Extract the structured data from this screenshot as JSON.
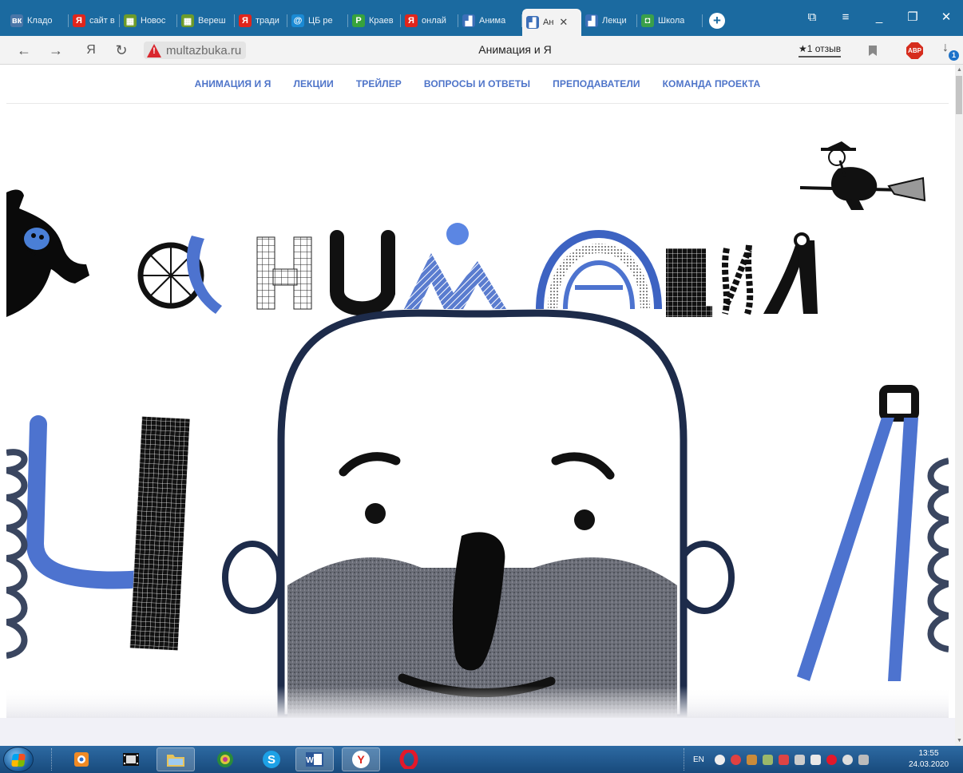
{
  "browser": {
    "tabs": [
      {
        "title": "Кладо",
        "icon": "vk-icon",
        "color": "#4a76a8",
        "glyph": "вк"
      },
      {
        "title": "сайт в",
        "icon": "yandex-icon",
        "color": "#e1251b",
        "glyph": "Я"
      },
      {
        "title": "Новос",
        "icon": "site-icon",
        "color": "#6d9b2a",
        "glyph": "▦"
      },
      {
        "title": "Вереш",
        "icon": "site-icon",
        "color": "#6d9b2a",
        "glyph": "▦"
      },
      {
        "title": "тради",
        "icon": "yandex-icon",
        "color": "#e1251b",
        "glyph": "Я"
      },
      {
        "title": "ЦБ ре",
        "icon": "mail-icon",
        "color": "#1a8ad4",
        "glyph": "@"
      },
      {
        "title": "Краев",
        "icon": "site-icon",
        "color": "#37a33c",
        "glyph": "Р"
      },
      {
        "title": "онлай",
        "icon": "yandex-icon",
        "color": "#e1251b",
        "glyph": "Я"
      },
      {
        "title": "Анима",
        "icon": "multazbuka-icon",
        "color": "#3c6fb8",
        "glyph": "▟"
      },
      {
        "title": "Ан",
        "icon": "multazbuka-icon",
        "color": "#3c6fb8",
        "glyph": "▟",
        "active": true
      },
      {
        "title": "Лекци",
        "icon": "multazbuka-icon",
        "color": "#3c6fb8",
        "glyph": "▟"
      },
      {
        "title": "Школа",
        "icon": "site-icon",
        "color": "#3aa04a",
        "glyph": "◘"
      }
    ],
    "address": {
      "url": "multazbuka.ru",
      "page_title": "Анимация и Я",
      "reviews": "★1 отзыв",
      "download_badge": "1"
    }
  },
  "site": {
    "nav": [
      "АНИМАЦИЯ И Я",
      "ЛЕКЦИИ",
      "ТРЕЙЛЕР",
      "ВОПРОСЫ И ОТВЕТЫ",
      "ПРЕПОДАВАТЕЛИ",
      "КОМАНДА ПРОЕКТА"
    ],
    "hero_alt": "Анимация и Я"
  },
  "taskbar": {
    "language": "EN",
    "time": "13:55",
    "date": "24.03.2020"
  }
}
